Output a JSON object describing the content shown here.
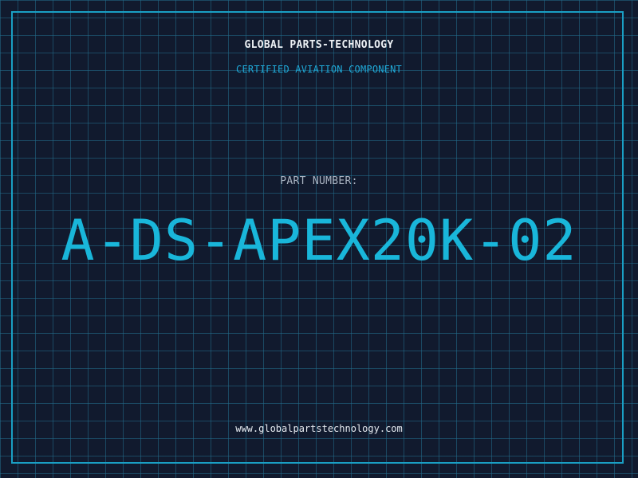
{
  "header": {
    "company_name": "GLOBAL PARTS-TECHNOLOGY",
    "subtitle": "CERTIFIED AVIATION COMPONENT"
  },
  "main": {
    "part_number_label": "PART NUMBER:",
    "part_number": "A-DS-APEX20K-02"
  },
  "footer": {
    "website": "www.globalpartstechnology.com"
  },
  "colors": {
    "background": "#111a2e",
    "grid": "#226e8c",
    "accent": "#19b6da",
    "text": "#eef2f6"
  }
}
